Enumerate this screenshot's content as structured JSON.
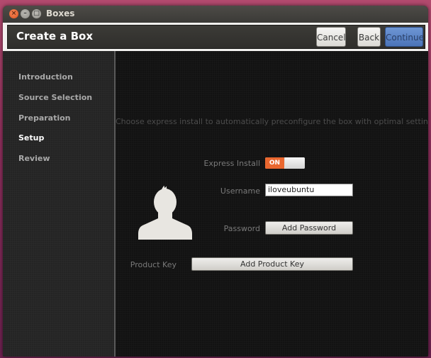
{
  "window": {
    "title": "Boxes"
  },
  "header": {
    "title": "Create a Box",
    "cancel_label": "Cancel",
    "back_label": "Back",
    "continue_label": "Continue"
  },
  "sidebar": {
    "items": [
      {
        "label": "Introduction"
      },
      {
        "label": "Source Selection"
      },
      {
        "label": "Preparation"
      },
      {
        "label": "Setup",
        "active": true
      },
      {
        "label": "Review"
      }
    ]
  },
  "main": {
    "hint": "Choose express install to automatically preconfigure the box with optimal settings.",
    "express_install": {
      "label": "Express Install",
      "state": "ON"
    },
    "username": {
      "label": "Username",
      "value": "iloveubuntu"
    },
    "password": {
      "label": "Password",
      "button": "Add Password"
    },
    "product_key": {
      "label": "Product Key",
      "button": "Add Product Key"
    },
    "avatar_icon": "user-silhouette-icon",
    "colors": {
      "accent": "#e9672f",
      "continue": "#5b84c6"
    }
  }
}
